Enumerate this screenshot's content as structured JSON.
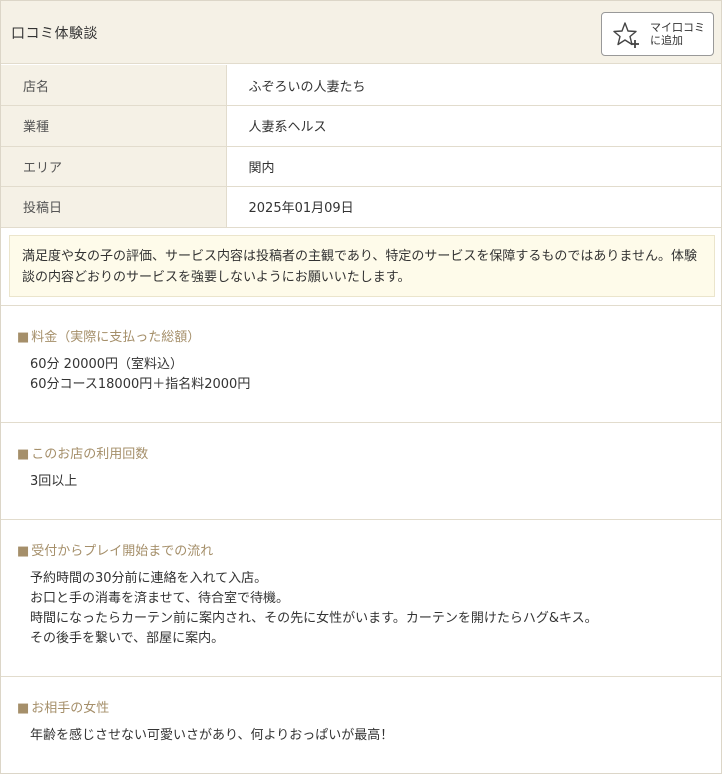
{
  "header": {
    "title": "口コミ体験談",
    "myreview_button": {
      "line1": "マイ口コミ",
      "line2": "に追加"
    }
  },
  "info_rows": [
    {
      "label": "店名",
      "value": "ふぞろいの人妻たち"
    },
    {
      "label": "業種",
      "value": "人妻系ヘルス"
    },
    {
      "label": "エリア",
      "value": "関内"
    },
    {
      "label": "投稿日",
      "value": "2025年01月09日"
    }
  ],
  "notice": "満足度や女の子の評価、サービス内容は投稿者の主観であり、特定のサービスを保障するものではありません。体験談の内容どおりのサービスを強要しないようにお願いいたします。",
  "sections": [
    {
      "title": "料金（実際に支払った総額）",
      "body": "60分 20000円（室料込）\n60分コース18000円＋指名料2000円"
    },
    {
      "title": "このお店の利用回数",
      "body": "3回以上"
    },
    {
      "title": "受付からプレイ開始までの流れ",
      "body": "予約時間の30分前に連絡を入れて入店。\nお口と手の消毒を済ませて、待合室で待機。\n時間になったらカーテン前に案内され、その先に女性がいます。カーテンを開けたらハグ&キス。\nその後手を繋いで、部屋に案内。"
    },
    {
      "title": "お相手の女性",
      "body": "年齢を感じさせない可愛いさがあり、何よりおっぱいが最高！"
    }
  ],
  "colors": {
    "accent": "#a58f6a",
    "header_bg": "#f5f1e6",
    "notice_bg": "#fefbea"
  }
}
